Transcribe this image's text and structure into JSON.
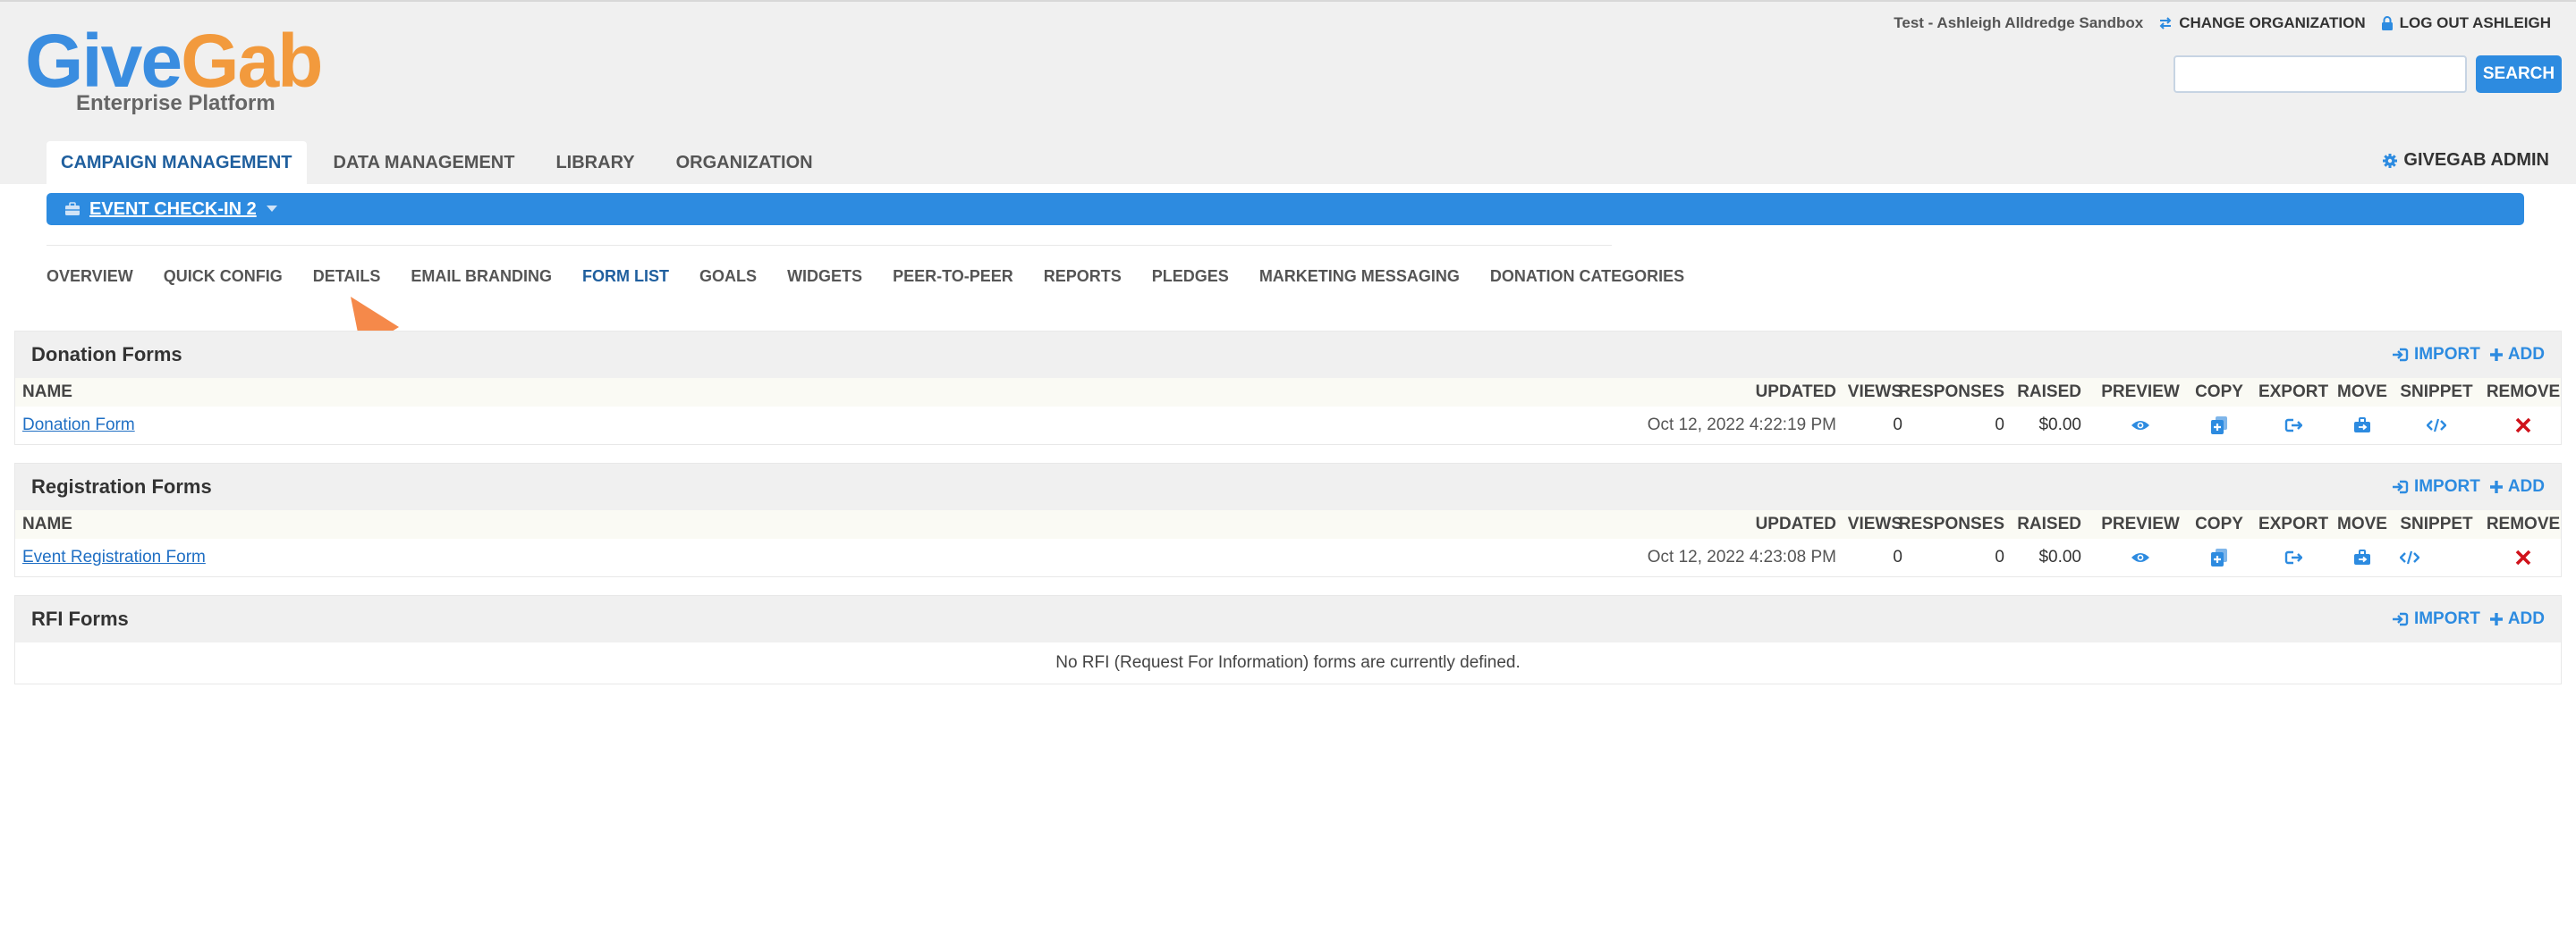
{
  "brand": {
    "logo_give": "Give",
    "logo_gab": "Gab",
    "tagline": "Enterprise Platform",
    "give_color": "#3a8de0",
    "gab_color": "#f29a3d"
  },
  "top_bar": {
    "org_name": "Test - Ashleigh Alldredge Sandbox",
    "change_org_label": "CHANGE ORGANIZATION",
    "logout_label": "LOG OUT ASHLEIGH",
    "change_org_icon": "swap-arrows-icon",
    "logout_icon": "lock-icon"
  },
  "search": {
    "value": "",
    "placeholder": "",
    "button_label": "SEARCH"
  },
  "main_nav": {
    "tabs": [
      "CAMPAIGN MANAGEMENT",
      "DATA MANAGEMENT",
      "LIBRARY",
      "ORGANIZATION"
    ],
    "active": "CAMPAIGN MANAGEMENT",
    "admin_label": "GIVEGAB ADMIN",
    "admin_icon": "gear-icon"
  },
  "campaign": {
    "selected": "EVENT CHECK-IN 2",
    "icon": "briefcase-icon",
    "bar_color": "#2d8be0"
  },
  "sub_nav": {
    "tabs": [
      "OVERVIEW",
      "QUICK CONFIG",
      "DETAILS",
      "EMAIL BRANDING",
      "FORM LIST",
      "GOALS",
      "WIDGETS",
      "PEER-TO-PEER",
      "REPORTS",
      "PLEDGES",
      "MARKETING MESSAGING",
      "DONATION CATEGORIES"
    ],
    "active": "FORM LIST"
  },
  "annotation": {
    "arrow_color": "#f5894a",
    "points_to": "DETAILS"
  },
  "sections": {
    "import_label": "IMPORT",
    "add_label": "ADD",
    "columns": {
      "name": "NAME",
      "updated": "UPDATED",
      "views": "VIEWS",
      "responses": "RESPONSES",
      "raised": "RAISED",
      "preview": "PREVIEW",
      "copy": "COPY",
      "export": "EXPORT",
      "move": "MOVE",
      "snippet": "SNIPPET",
      "remove": "REMOVE"
    },
    "donation": {
      "title": "Donation Forms",
      "rows": [
        {
          "name": "Donation Form",
          "updated": "Oct 12, 2022 4:22:19 PM",
          "views": "0",
          "responses": "0",
          "raised": "$0.00"
        }
      ]
    },
    "registration": {
      "title": "Registration Forms",
      "rows": [
        {
          "name": "Event Registration Form",
          "updated": "Oct 12, 2022 4:23:08 PM",
          "views": "0",
          "responses": "0",
          "raised": "$0.00"
        }
      ]
    },
    "rfi": {
      "title": "RFI Forms",
      "empty_message": "No RFI (Request For Information) forms are currently defined."
    }
  }
}
